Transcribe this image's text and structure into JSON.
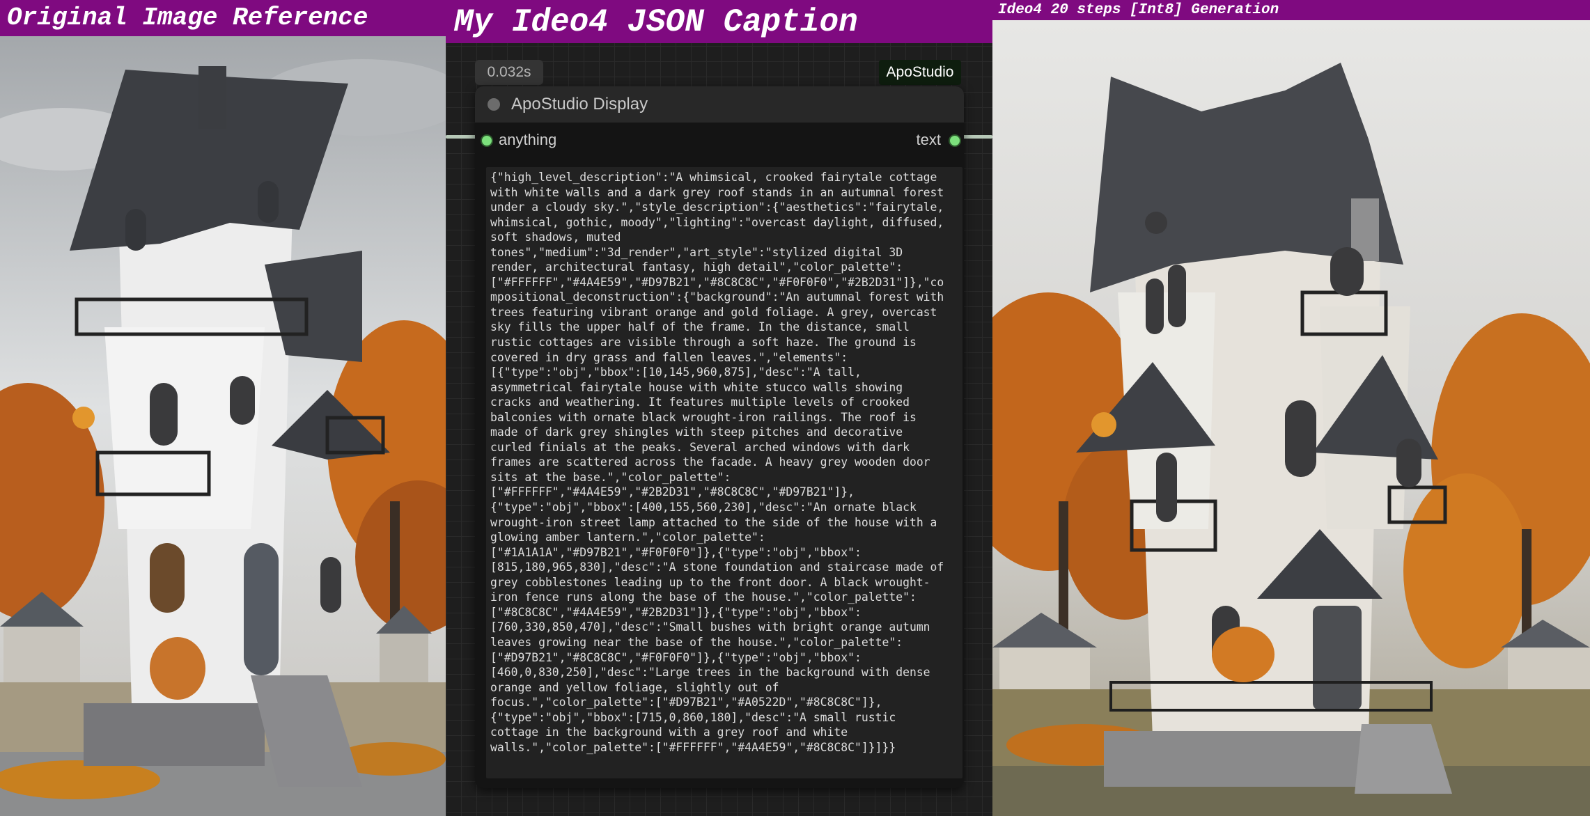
{
  "panels": {
    "left_title": "Original Image Reference",
    "middle_title": "My Ideo4 JSON Caption",
    "right_title": "Ideo4 20 steps [Int8] Generation"
  },
  "node": {
    "timer": "0.032s",
    "brand": "ApoStudio",
    "title": "ApoStudio Display",
    "input_label": "anything",
    "output_label": "text",
    "json_lines": [
      "{\"high_level_description\":\"A whimsical, crooked fairytale cottage",
      "with white walls and a dark grey roof stands in an autumnal forest",
      "under a cloudy sky.\",\"style_description\":{\"aesthetics\":\"fairytale,",
      "whimsical, gothic, moody\",\"lighting\":\"overcast daylight, diffused,",
      "soft shadows, muted",
      "tones\",\"medium\":\"3d_render\",\"art_style\":\"stylized digital 3D",
      "render, architectural fantasy, high detail\",\"color_palette\":",
      "[\"#FFFFFF\",\"#4A4E59\",\"#D97B21\",\"#8C8C8C\",\"#F0F0F0\",\"#2B2D31\"]},\"co",
      "mpositional_deconstruction\":{\"background\":\"An autumnal forest with",
      "trees featuring vibrant orange and gold foliage. A grey, overcast",
      "sky fills the upper half of the frame. In the distance, small",
      "rustic cottages are visible through a soft haze. The ground is",
      "covered in dry grass and fallen leaves.\",\"elements\":",
      "[{\"type\":\"obj\",\"bbox\":[10,145,960,875],\"desc\":\"A tall,",
      "asymmetrical fairytale house with white stucco walls showing",
      "cracks and weathering. It features multiple levels of crooked",
      "balconies with ornate black wrought-iron railings. The roof is",
      "made of dark grey shingles with steep pitches and decorative",
      "curled finials at the peaks. Several arched windows with dark",
      "frames are scattered across the facade. A heavy grey wooden door",
      "sits at the base.\",\"color_palette\":",
      "[\"#FFFFFF\",\"#4A4E59\",\"#2B2D31\",\"#8C8C8C\",\"#D97B21\"]},",
      "{\"type\":\"obj\",\"bbox\":[400,155,560,230],\"desc\":\"An ornate black",
      "wrought-iron street lamp attached to the side of the house with a",
      "glowing amber lantern.\",\"color_palette\":",
      "[\"#1A1A1A\",\"#D97B21\",\"#F0F0F0\"]},{\"type\":\"obj\",\"bbox\":",
      "[815,180,965,830],\"desc\":\"A stone foundation and staircase made of",
      "grey cobblestones leading up to the front door. A black wrought-",
      "iron fence runs along the base of the house.\",\"color_palette\":",
      "[\"#8C8C8C\",\"#4A4E59\",\"#2B2D31\"]},{\"type\":\"obj\",\"bbox\":",
      "[760,330,850,470],\"desc\":\"Small bushes with bright orange autumn",
      "leaves growing near the base of the house.\",\"color_palette\":",
      "[\"#D97B21\",\"#8C8C8C\",\"#F0F0F0\"]},{\"type\":\"obj\",\"bbox\":",
      "[460,0,830,250],\"desc\":\"Large trees in the background with dense",
      "orange and yellow foliage, slightly out of",
      "focus.\",\"color_palette\":[\"#D97B21\",\"#A0522D\",\"#8C8C8C\"]},",
      "{\"type\":\"obj\",\"bbox\":[715,0,860,180],\"desc\":\"A small rustic",
      "cottage in the background with a grey roof and white",
      "walls.\",\"color_palette\":[\"#FFFFFF\",\"#4A4E59\",\"#8C8C8C\"]}]}}"
    ]
  },
  "colors": {
    "header_purple": "#7f0a80",
    "port_green": "#7ce07c",
    "foliage_orange": "#D97B21",
    "wall_white": "#F0F0F0",
    "roof_grey": "#4A4E59"
  }
}
